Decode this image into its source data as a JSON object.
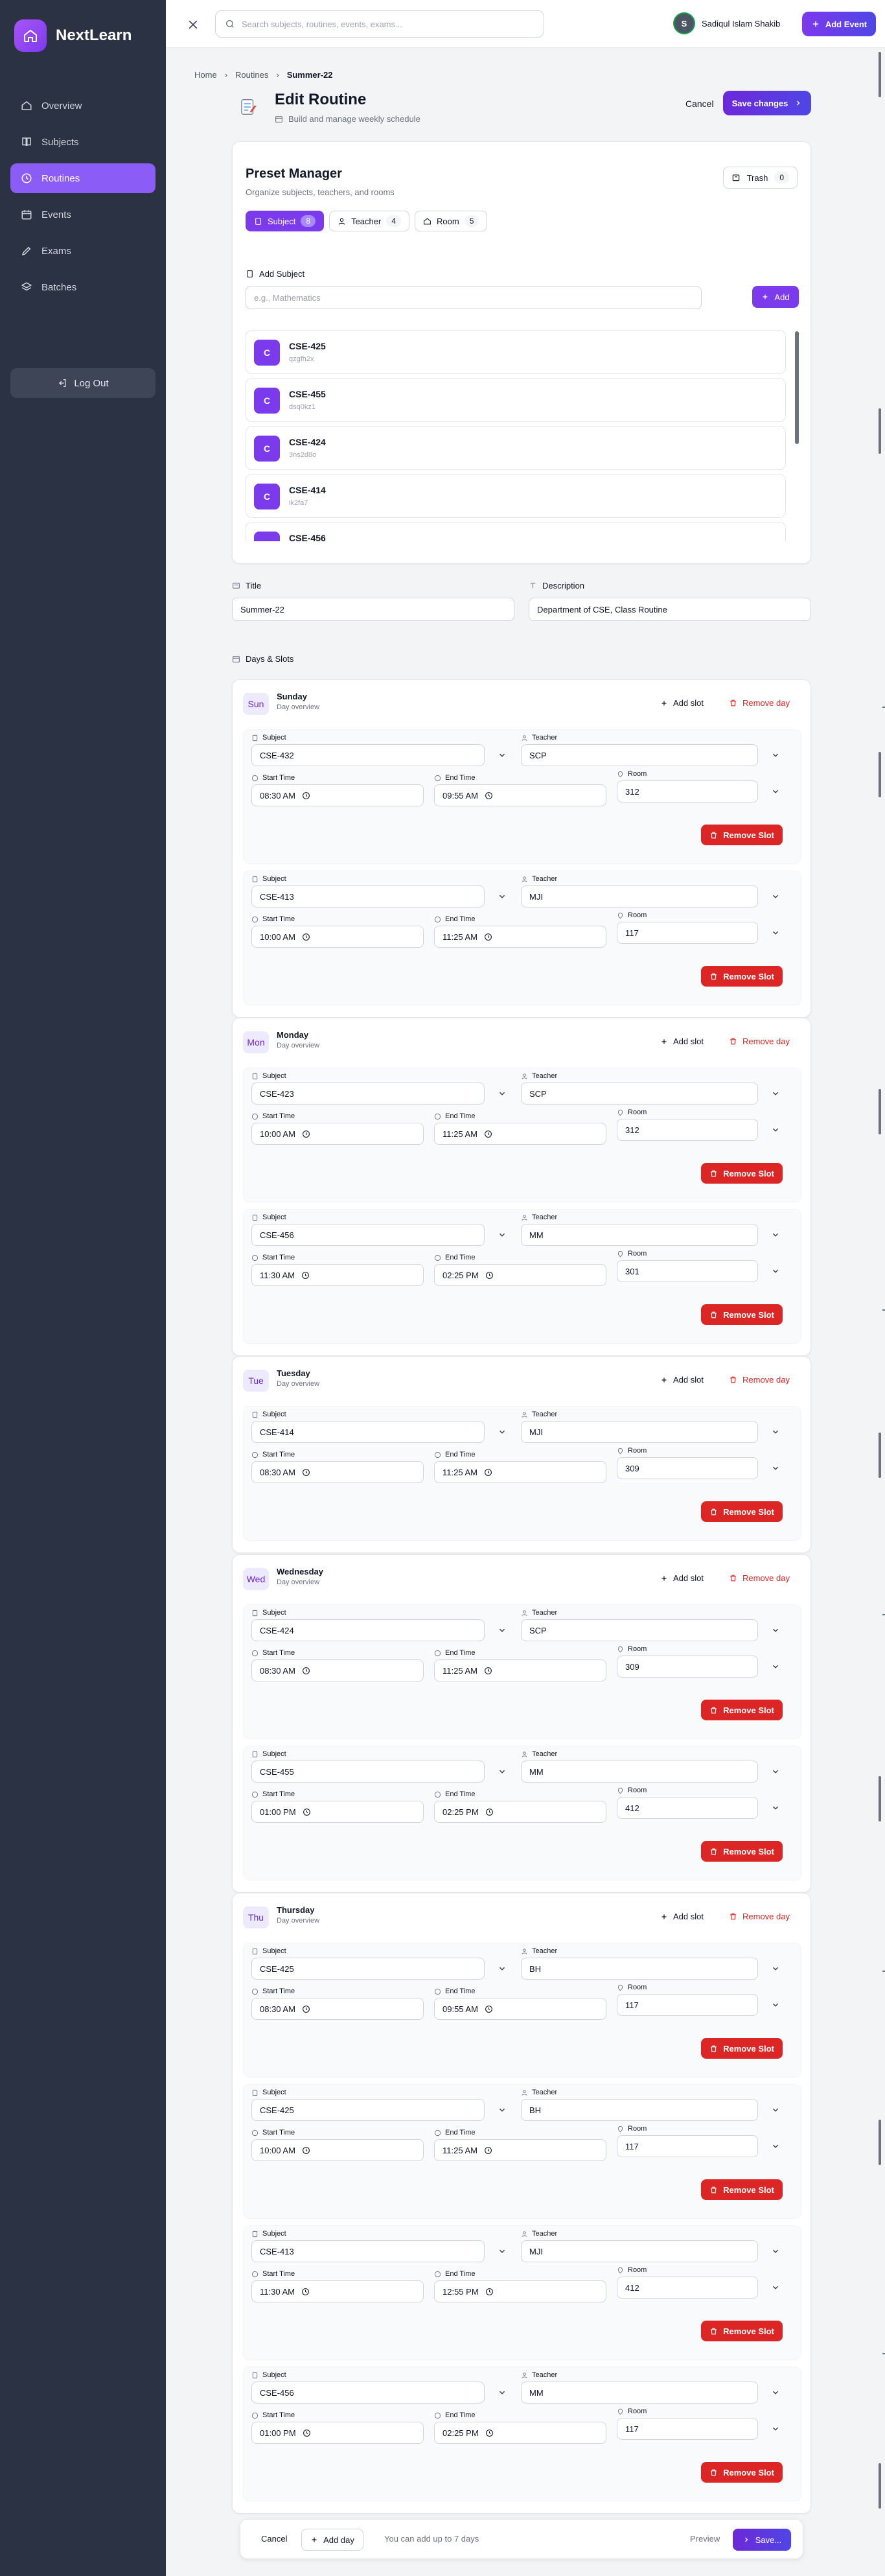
{
  "brand": {
    "name": "NextLearn"
  },
  "sidebar": {
    "items": [
      {
        "label": "Overview",
        "icon": "home-icon"
      },
      {
        "label": "Subjects",
        "icon": "book-icon"
      },
      {
        "label": "Routines",
        "icon": "clock-icon",
        "active": true
      },
      {
        "label": "Events",
        "icon": "calendar-icon"
      },
      {
        "label": "Exams",
        "icon": "pen-icon"
      },
      {
        "label": "Batches",
        "icon": "layers-icon"
      }
    ],
    "logout_label": "Log Out"
  },
  "topbar": {
    "search_placeholder": "Search subjects, routines, events, exams...",
    "user_name": "Sadiqul Islam Shakib",
    "add_event_label": "Add Event"
  },
  "breadcrumb": {
    "home": "Home",
    "section": "Routines",
    "current": "Summer-22"
  },
  "page": {
    "title": "Edit Routine",
    "subtitle": "Build and manage weekly schedule",
    "cancel_label": "Cancel",
    "save_label": "Save changes"
  },
  "preset_manager": {
    "title": "Preset Manager",
    "subtitle": "Organize subjects, teachers, and rooms",
    "trash_label": "Trash",
    "trash_count": "0",
    "tabs": [
      {
        "label": "Subject",
        "count": "8"
      },
      {
        "label": "Teacher",
        "count": "4"
      },
      {
        "label": "Room",
        "count": "5"
      }
    ],
    "add_label": "Add Subject",
    "add_placeholder": "e.g., Mathematics",
    "add_button": "Add",
    "subjects": [
      {
        "badge": "C",
        "name": "CSE-425",
        "code": "qzgfh2x"
      },
      {
        "badge": "C",
        "name": "CSE-455",
        "code": "dsq0kz1"
      },
      {
        "badge": "C",
        "name": "CSE-424",
        "code": "3ns2d8o"
      },
      {
        "badge": "C",
        "name": "CSE-414",
        "code": "ik2fa7"
      },
      {
        "badge": "C",
        "name": "CSE-456",
        "code": ""
      }
    ]
  },
  "form": {
    "title_label": "Title",
    "title_value": "Summer-22",
    "description_label": "Description",
    "description_value": "Department of CSE, Class Routine",
    "days_label": "Days & Slots"
  },
  "labels": {
    "day_overview": "Day overview",
    "add_slot": "Add slot",
    "remove_day": "Remove day",
    "subject": "Subject",
    "teacher": "Teacher",
    "start_time": "Start Time",
    "end_time": "End Time",
    "room": "Room",
    "remove_slot": "Remove Slot"
  },
  "days": [
    {
      "short": "Sun",
      "name": "Sunday",
      "slots": [
        {
          "subject": "CSE-432",
          "teacher": "SCP",
          "start": "08:30 AM",
          "end": "09:55 AM",
          "room": "312"
        },
        {
          "subject": "CSE-413",
          "teacher": "MJI",
          "start": "10:00 AM",
          "end": "11:25 AM",
          "room": "117"
        }
      ]
    },
    {
      "short": "Mon",
      "name": "Monday",
      "slots": [
        {
          "subject": "CSE-423",
          "teacher": "SCP",
          "start": "10:00 AM",
          "end": "11:25 AM",
          "room": "312"
        },
        {
          "subject": "CSE-456",
          "teacher": "MM",
          "start": "11:30 AM",
          "end": "02:25 PM",
          "room": "301"
        }
      ]
    },
    {
      "short": "Tue",
      "name": "Tuesday",
      "slots": [
        {
          "subject": "CSE-414",
          "teacher": "MJI",
          "start": "08:30 AM",
          "end": "11:25 AM",
          "room": "309"
        }
      ]
    },
    {
      "short": "Wed",
      "name": "Wednesday",
      "slots": [
        {
          "subject": "CSE-424",
          "teacher": "SCP",
          "start": "08:30 AM",
          "end": "11:25 AM",
          "room": "309"
        },
        {
          "subject": "CSE-455",
          "teacher": "MM",
          "start": "01:00 PM",
          "end": "02:25 PM",
          "room": "412"
        }
      ]
    },
    {
      "short": "Thu",
      "name": "Thursday",
      "slots": [
        {
          "subject": "CSE-425",
          "teacher": "BH",
          "start": "08:30 AM",
          "end": "09:55 AM",
          "room": "117"
        },
        {
          "subject": "CSE-425",
          "teacher": "BH",
          "start": "10:00 AM",
          "end": "11:25 AM",
          "room": "117"
        },
        {
          "subject": "CSE-413",
          "teacher": "MJI",
          "start": "11:30 AM",
          "end": "12:55 PM",
          "room": "412"
        },
        {
          "subject": "CSE-456",
          "teacher": "MM",
          "start": "01:00 PM",
          "end": "02:25 PM",
          "room": "117"
        }
      ]
    }
  ],
  "footer": {
    "cancel_label": "Cancel",
    "add_day_label": "Add day",
    "hint": "You can add up to 7 days",
    "preview_label": "Preview",
    "save_label": "Save..."
  },
  "colors": {
    "accent": "#7c3aed",
    "danger": "#dc2626",
    "sidebar": "#2b3244"
  }
}
